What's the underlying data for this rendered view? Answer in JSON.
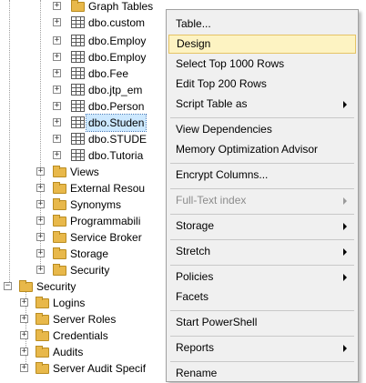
{
  "tree": {
    "top_items": [
      {
        "label": "Graph Tables",
        "icon": "folder-icon"
      },
      {
        "label": "dbo.custom",
        "icon": "table-icon"
      },
      {
        "label": "dbo.Employ",
        "icon": "table-icon"
      },
      {
        "label": "dbo.Employ",
        "icon": "table-icon"
      },
      {
        "label": "dbo.Fee",
        "icon": "table-icon"
      },
      {
        "label": "dbo.jtp_em",
        "icon": "table-icon"
      },
      {
        "label": "dbo.Person",
        "icon": "table-icon"
      },
      {
        "label": "dbo.Studen",
        "icon": "table-icon",
        "selected": true
      },
      {
        "label": "dbo.STUDE",
        "icon": "table-icon"
      },
      {
        "label": "dbo.Tutoria",
        "icon": "table-icon"
      }
    ],
    "db_folders": [
      "Views",
      "External Resou",
      "Synonyms",
      "Programmabili",
      "Service Broker",
      "Storage",
      "Security"
    ],
    "security_label": "Security",
    "security_children": [
      "Logins",
      "Server Roles",
      "Credentials",
      "Audits",
      "Server Audit Specif"
    ]
  },
  "context_menu": {
    "items": [
      {
        "label": "Table...",
        "submenu": false
      },
      {
        "label": "Design",
        "submenu": false,
        "highlighted": true
      },
      {
        "label": "Select Top 1000 Rows",
        "submenu": false
      },
      {
        "label": "Edit Top 200 Rows",
        "submenu": false
      },
      {
        "label": "Script Table as",
        "submenu": true
      },
      {
        "label": "View Dependencies",
        "submenu": false
      },
      {
        "label": "Memory Optimization Advisor",
        "submenu": false
      },
      {
        "label": "Encrypt Columns...",
        "submenu": false
      },
      {
        "label": "Full-Text index",
        "submenu": true,
        "disabled": true
      },
      {
        "label": "Storage",
        "submenu": true
      },
      {
        "label": "Stretch",
        "submenu": true
      },
      {
        "label": "Policies",
        "submenu": true
      },
      {
        "label": "Facets",
        "submenu": false
      },
      {
        "label": "Start PowerShell",
        "submenu": false
      },
      {
        "label": "Reports",
        "submenu": true
      },
      {
        "label": "Rename",
        "submenu": false
      }
    ]
  },
  "colors": {
    "selection": "#cce8ff",
    "menu_highlight": "#fdf3c2",
    "menu_background": "#f0f0f0",
    "folder": "#e8b84a"
  }
}
